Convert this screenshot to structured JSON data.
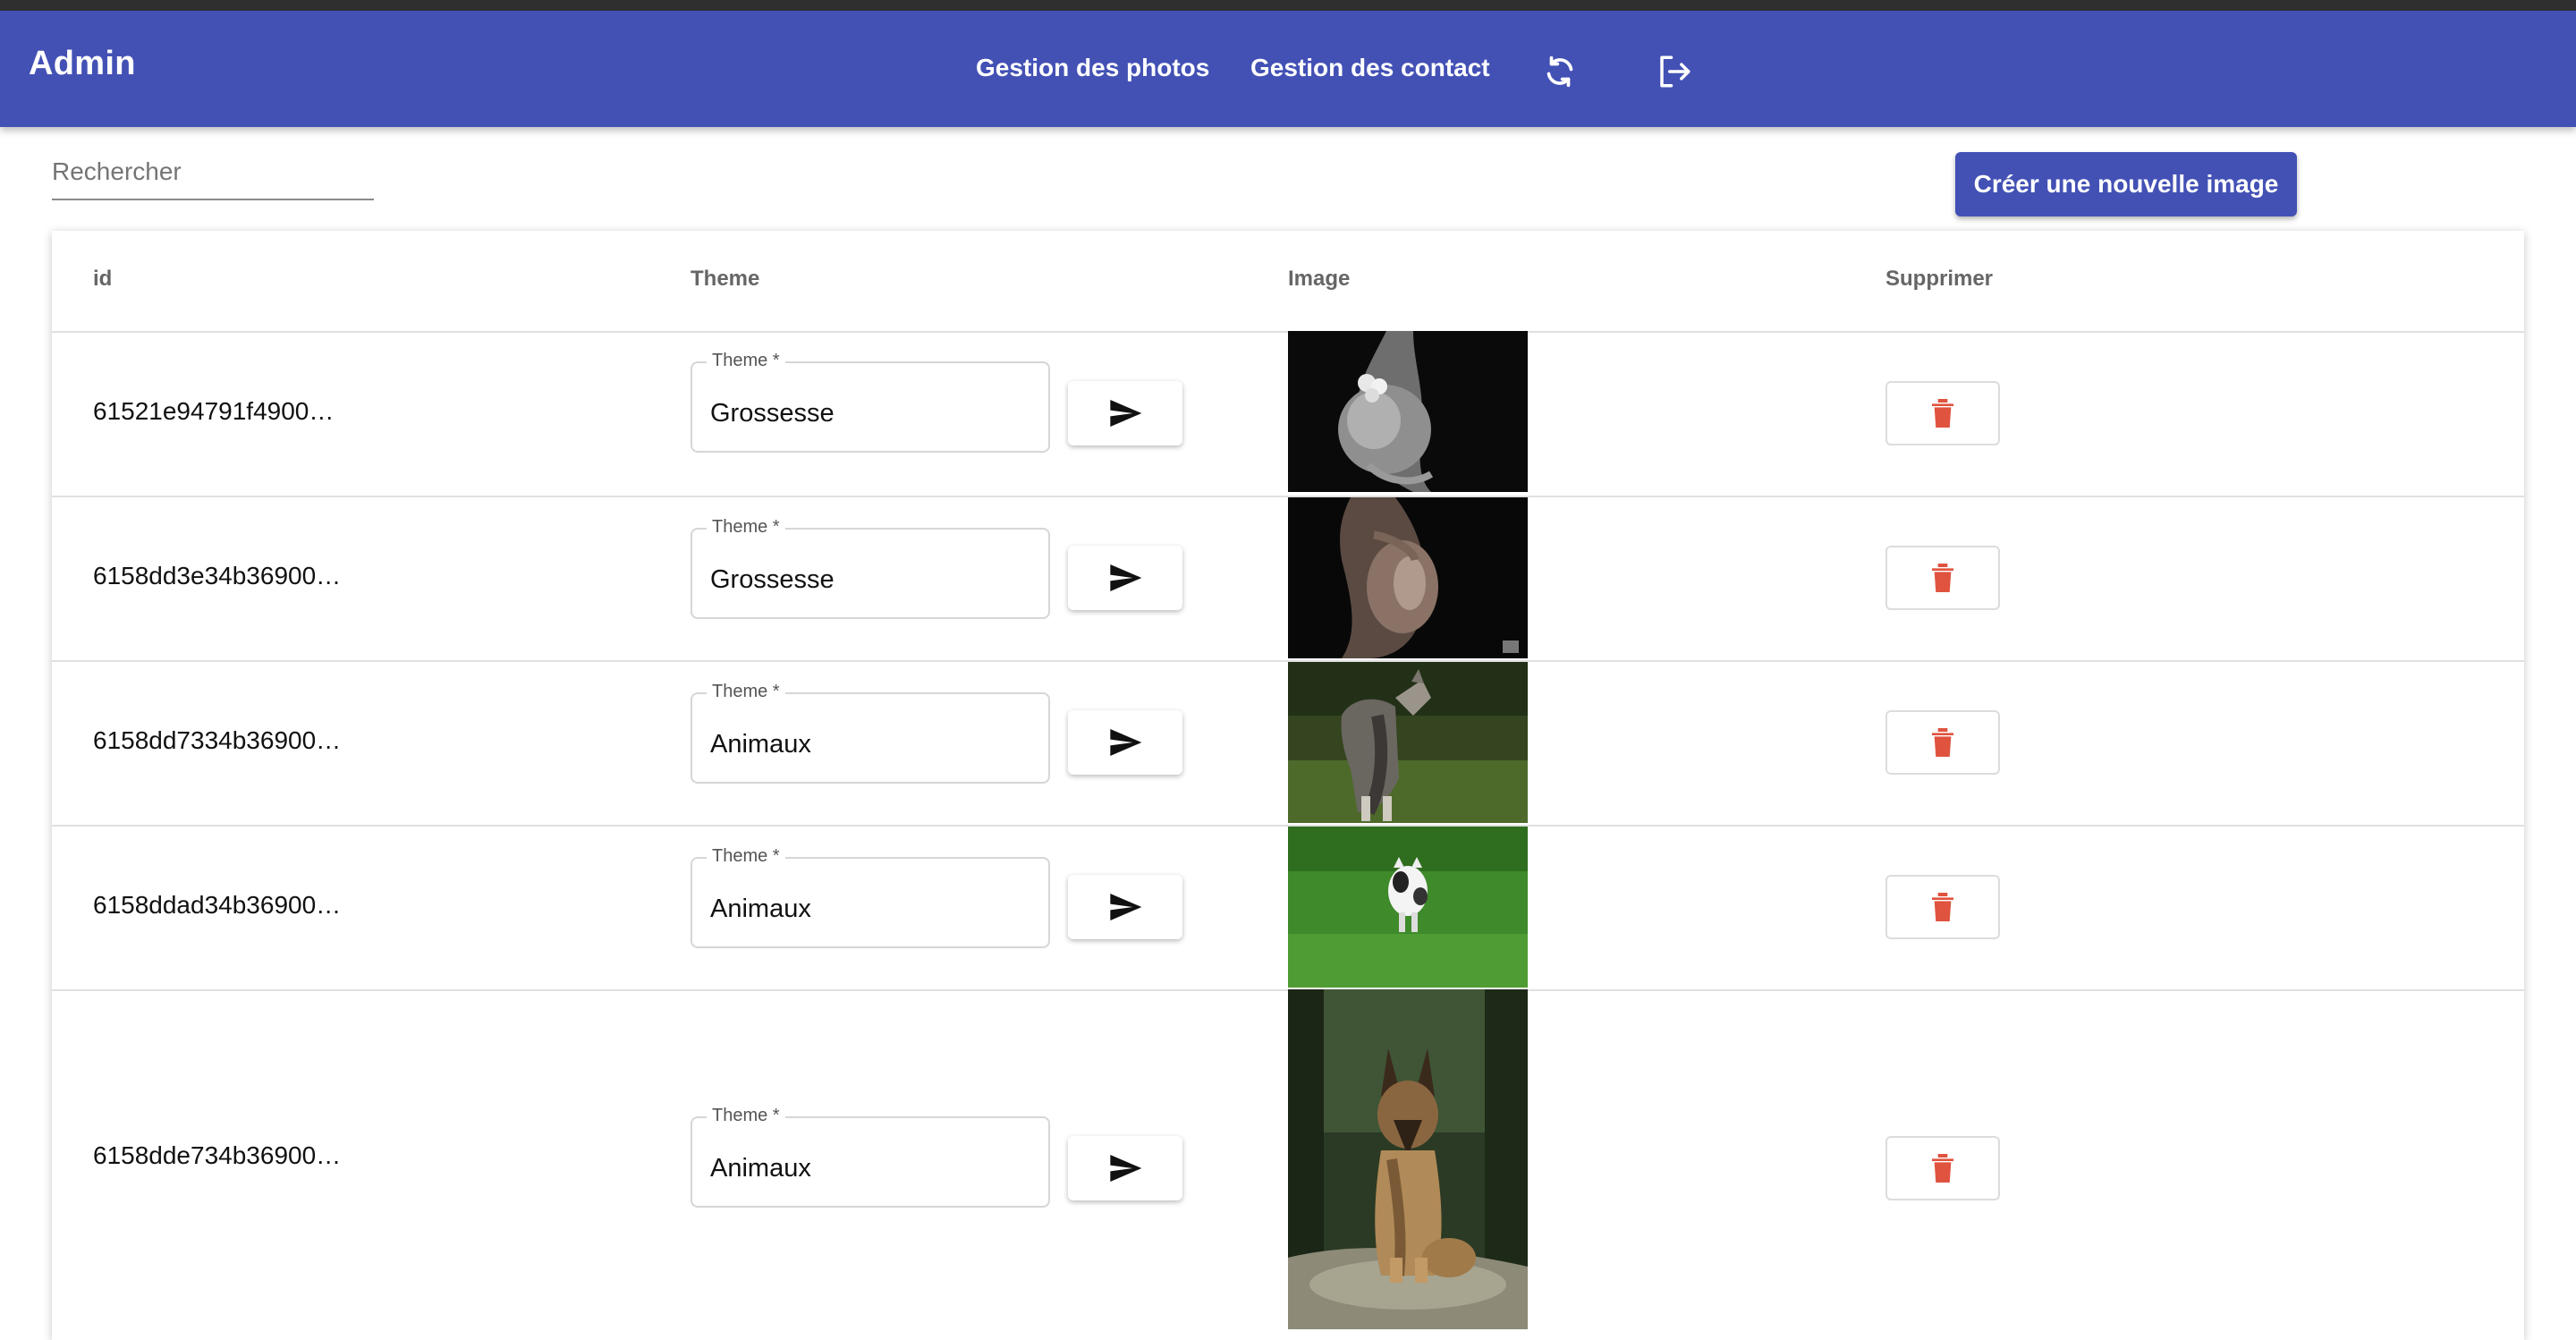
{
  "appbar": {
    "title": "Admin",
    "nav": [
      "Gestion des photos",
      "Gestion des contact"
    ],
    "icons": [
      "refresh-icon",
      "logout-icon"
    ],
    "color": "#4351b5"
  },
  "search": {
    "placeholder": "Rechercher",
    "value": ""
  },
  "create_button": {
    "label": "Créer une nouvelle image"
  },
  "table": {
    "headers": [
      "id",
      "Theme",
      "Image",
      "Supprimer"
    ],
    "theme_field_label": "Theme *",
    "rows": [
      {
        "id": "61521e94791f4900…",
        "theme": "Grossesse"
      },
      {
        "id": "6158dd3e34b36900…",
        "theme": "Grossesse"
      },
      {
        "id": "6158dd7334b36900…",
        "theme": "Animaux"
      },
      {
        "id": "6158ddad34b36900…",
        "theme": "Animaux"
      },
      {
        "id": "6158dde734b36900…",
        "theme": "Animaux"
      }
    ]
  },
  "colors": {
    "primary": "#4351b5",
    "delete_icon": "#e0533f"
  }
}
